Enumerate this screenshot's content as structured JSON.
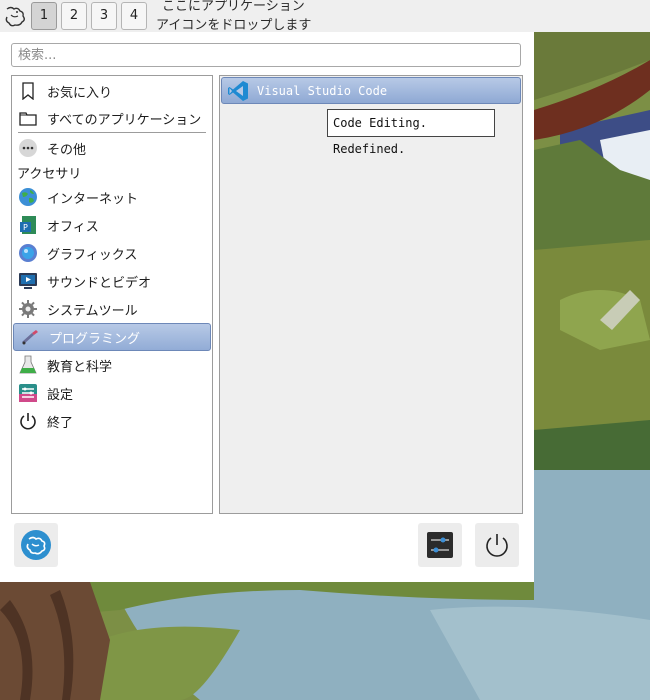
{
  "panel": {
    "workspaces": [
      "1",
      "2",
      "3",
      "4"
    ],
    "active_workspace": "1",
    "drop_hint_line1": "ここにアプリケーション",
    "drop_hint_line2": "アイコンをドロップします"
  },
  "search": {
    "placeholder": "検索...",
    "value": ""
  },
  "categories": {
    "favorites": "お気に入り",
    "all_apps": "すべてのアプリケーション",
    "other": "その他",
    "heading_accessories": "アクセサリ",
    "internet": "インターネット",
    "office": "オフィス",
    "graphics": "グラフィックス",
    "sound_video": "サウンドとビデオ",
    "system_tools": "システムツール",
    "programming": "プログラミング",
    "education_science": "教育と科学",
    "settings": "設定",
    "quit": "終了"
  },
  "apps": [
    {
      "name": "Visual Studio Code",
      "tooltip": "Code Editing. Redefined."
    }
  ],
  "colors": {
    "selection_top": "#b7c9e6",
    "selection_bottom": "#92acd6",
    "vscode_blue": "#1f8ad2"
  }
}
